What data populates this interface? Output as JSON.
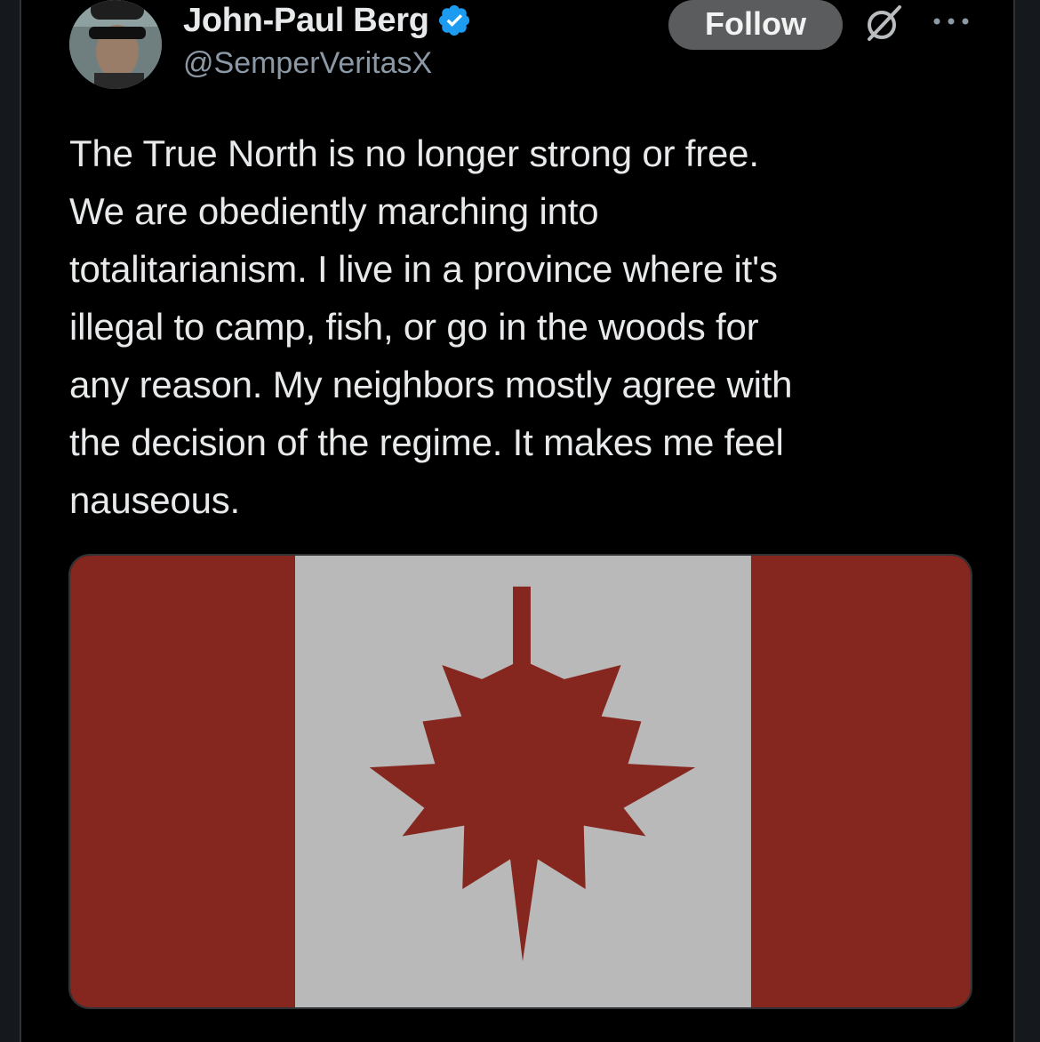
{
  "tweet": {
    "author_name": "John-Paul Berg",
    "handle": "@SemperVeritasX",
    "follow_label": "Follow",
    "lines": [
      "The True North is no longer strong or free.",
      "We are obediently marching into",
      "totalitarianism. I live in a province where it's",
      "illegal to camp, fish, or go in the woods for",
      "any reason. My neighbors mostly agree with",
      "the decision of the regime. It makes me feel",
      "nauseous."
    ],
    "verified": true
  },
  "icons": {
    "verified": "verified-badge-icon",
    "grok": "grok-icon",
    "more": "more-options-icon"
  },
  "media": {
    "subject": "Canadian flag with maple leaf",
    "colors": {
      "red": "#86271f",
      "white": "#b9b9b9"
    }
  },
  "colors": {
    "background": "#000000",
    "text": "#e7e9ea",
    "secondary_text": "#8b98a5",
    "follow_button": "#5a5c5e",
    "verified_blue": "#1d9bf0"
  }
}
